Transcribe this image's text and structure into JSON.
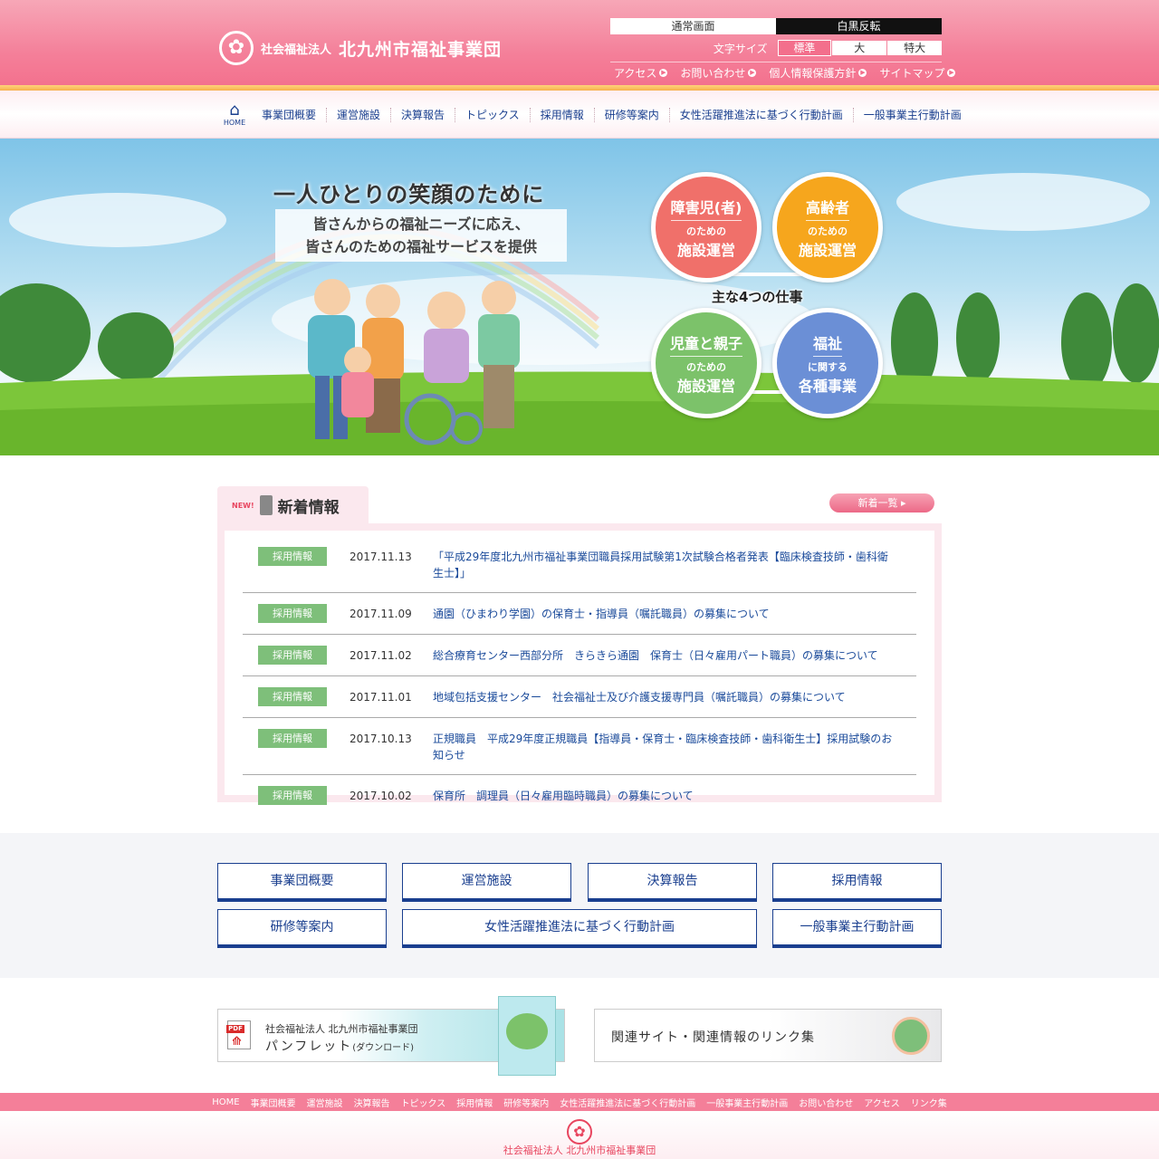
{
  "header": {
    "org_prefix": "社会福祉法人",
    "org_name": "北九州市福祉事業団",
    "logo_icon": "cherry-blossom-star-icon",
    "view_normal": "通常画面",
    "view_invert": "白黒反転",
    "font_size_label": "文字サイズ",
    "font_sizes": [
      "標準",
      "大",
      "特大"
    ],
    "utility_links": [
      "アクセス",
      "お問い合わせ",
      "個人情報保護方針",
      "サイトマップ"
    ]
  },
  "nav": {
    "home_label": "HOME",
    "items": [
      "事業団概要",
      "運営施設",
      "決算報告",
      "トピックス",
      "採用情報",
      "研修等案内",
      "女性活躍推進法に基づく行動計画",
      "一般事業主行動計画"
    ]
  },
  "hero": {
    "catch_main": "一人ひとりの笑顔のために",
    "catch_sub1": "皆さんからの福祉ニーズに応え、",
    "catch_sub2": "皆さんのための福祉サービスを提供",
    "work_label": "主な4つの仕事",
    "works": [
      {
        "top": "障害児(者)",
        "mid": "のための",
        "bot": "施設運営"
      },
      {
        "top": "高齢者",
        "mid": "のための",
        "bot": "施設運営"
      },
      {
        "top": "児童と親子",
        "mid": "のための",
        "bot": "施設運営"
      },
      {
        "top": "福祉",
        "mid": "に関する",
        "bot": "各種事業"
      }
    ]
  },
  "news": {
    "badge": "NEW!",
    "title": "新着情報",
    "all_label": "新着一覧 ▸",
    "items": [
      {
        "cat": "採用情報",
        "date": "2017.11.13",
        "text": "「平成29年度北九州市福祉事業団職員採用試験第1次試験合格者発表【臨床検査技師・歯科衛生士】」"
      },
      {
        "cat": "採用情報",
        "date": "2017.11.09",
        "text": "通園（ひまわり学園）の保育士・指導員（嘱託職員）の募集について"
      },
      {
        "cat": "採用情報",
        "date": "2017.11.02",
        "text": "総合療育センター西部分所　きらきら通園　保育士（日々雇用パート職員）の募集について"
      },
      {
        "cat": "採用情報",
        "date": "2017.11.01",
        "text": "地域包括支援センター　社会福祉士及び介護支援専門員（嘱託職員）の募集について"
      },
      {
        "cat": "採用情報",
        "date": "2017.10.13",
        "text": "正規職員　平成29年度正規職員【指導員・保育士・臨床検査技師・歯科衛生士】採用試験のお知らせ"
      },
      {
        "cat": "採用情報",
        "date": "2017.10.02",
        "text": "保育所　調理員（日々雇用臨時職員）の募集について"
      }
    ]
  },
  "buttons": [
    "事業団概要",
    "運営施設",
    "決算報告",
    "採用情報",
    "研修等案内",
    "女性活躍推進法に基づく行動計画",
    "一般事業主行動計画"
  ],
  "banners": {
    "pamphlet_org": "社会福祉法人 北九州市福祉事業団",
    "pamphlet_title": "パンフレット",
    "pamphlet_note": "(ダウンロード)",
    "pdf_label": "PDF",
    "links_title": "関連サイト・関連情報のリンク集"
  },
  "footer": {
    "links": [
      "HOME",
      "事業団概要",
      "運営施設",
      "決算報告",
      "トピックス",
      "採用情報",
      "研修等案内",
      "女性活躍推進法に基づく行動計画",
      "一般事業主行動計画",
      "お問い合わせ",
      "アクセス",
      "リンク集"
    ],
    "org_full": "社会福祉法人 北九州市福祉事業団"
  },
  "colors": {
    "brand_pink": "#f36f8c",
    "nav_blue": "#1a3f8f",
    "category_green": "#7ebf7a"
  }
}
